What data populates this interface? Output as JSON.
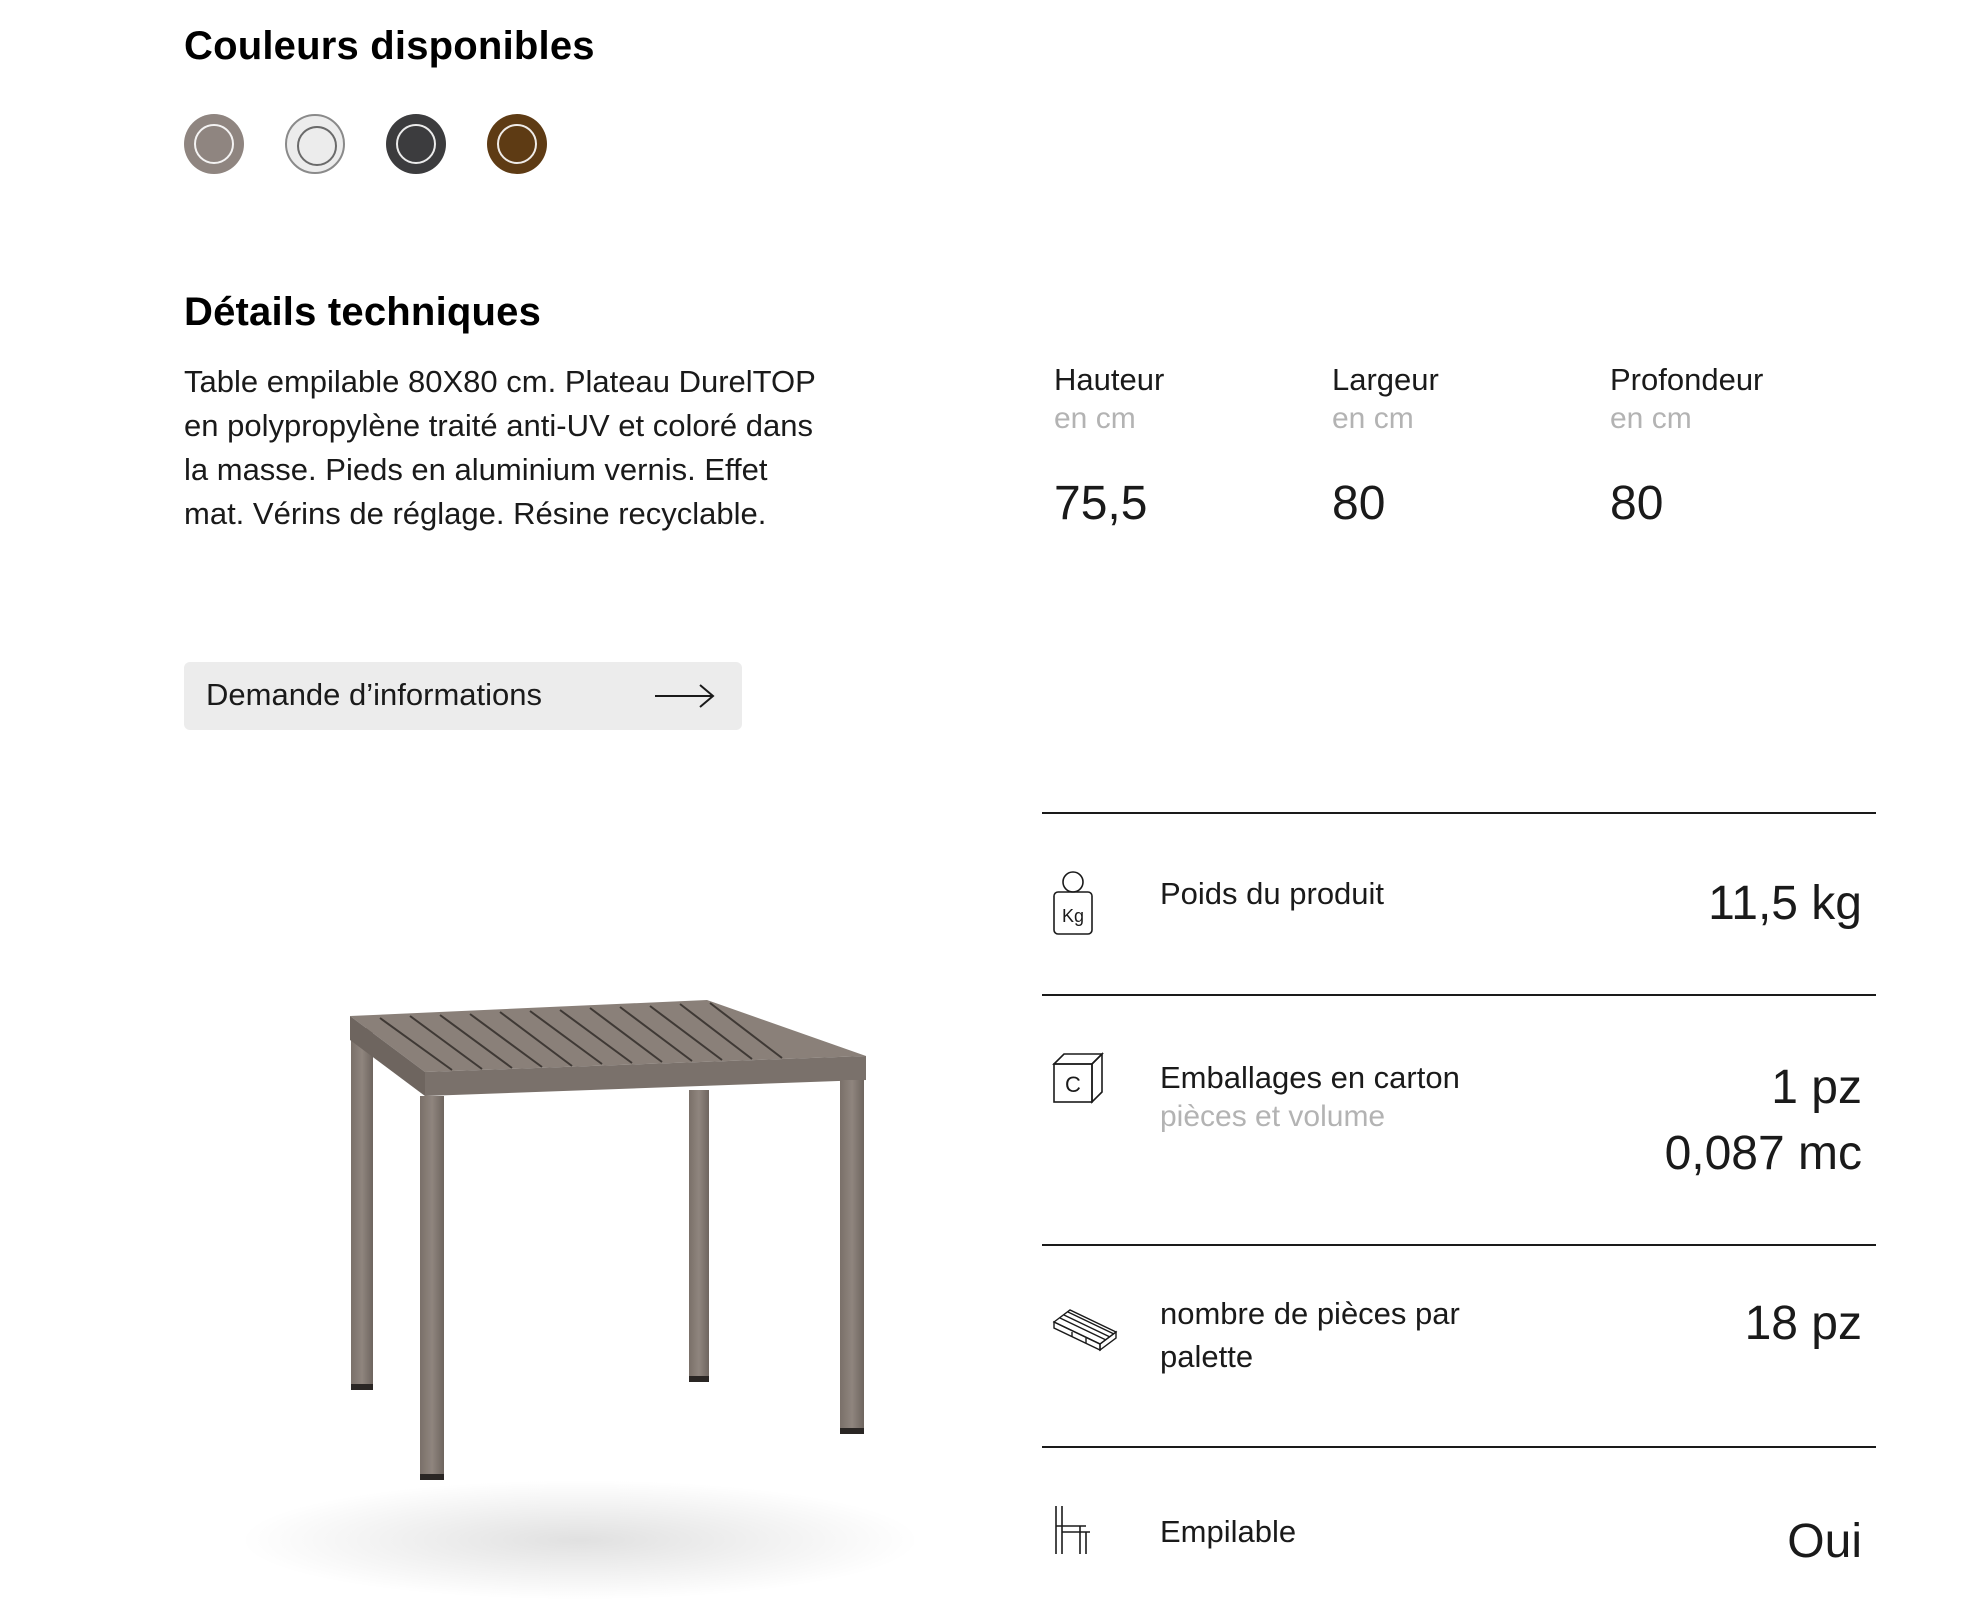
{
  "colors": {
    "title": "Couleurs disponibles",
    "swatches": [
      {
        "name": "tortora",
        "hex": "#8f8580"
      },
      {
        "name": "bianco",
        "hex": "#ececec"
      },
      {
        "name": "antracite",
        "hex": "#3c3c3e"
      },
      {
        "name": "caffe",
        "hex": "#5e3b14"
      }
    ]
  },
  "technical": {
    "title": "Détails techniques",
    "description": "Table empilable 80X80 cm. Plateau DurelTOP en polypropylène traité anti-UV et coloré dans la masse. Pieds en aluminium vernis. Effet mat. Vérins de réglage. Résine recyclable.",
    "dimensions": [
      {
        "label": "Hauteur",
        "unit": "en cm",
        "value": "75,5"
      },
      {
        "label": "Largeur",
        "unit": "en cm",
        "value": "80"
      },
      {
        "label": "Profondeur",
        "unit": "en cm",
        "value": "80"
      }
    ],
    "info_button_label": "Demande d’informations"
  },
  "specs": [
    {
      "icon": "weight-kg-icon",
      "label": "Poids du produit",
      "value": "11,5 kg"
    },
    {
      "icon": "carton-box-icon",
      "label": "Emballages en carton",
      "sub": "pièces et volume",
      "value": "1 pz",
      "value2": "0,087 mc"
    },
    {
      "icon": "pallet-icon",
      "label": "nombre de pièces par palette",
      "value": "18 pz"
    },
    {
      "icon": "stackable-icon",
      "label": "Empilable",
      "value": "Oui"
    }
  ],
  "icon_text": {
    "kg": "Kg",
    "c": "C"
  }
}
